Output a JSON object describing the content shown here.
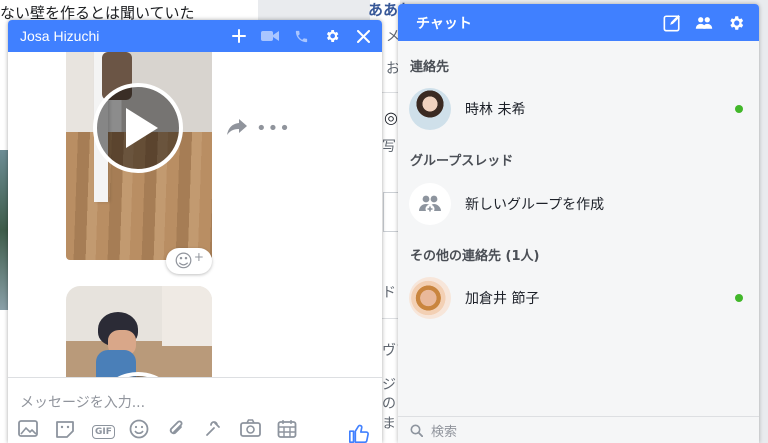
{
  "background": {
    "left_post_text": "ない壁を作るとは聞いていた",
    "mid_post_title": "ああお",
    "fragments": [
      "メ",
      "お",
      "写",
      "ドし",
      "ヴア",
      "ジ",
      "の",
      "ま"
    ]
  },
  "chat_window": {
    "contact_name": "Josa Hizuchi",
    "header_icons": [
      "plus-icon",
      "video-call-icon",
      "phone-icon",
      "gear-icon",
      "close-icon"
    ],
    "message_placeholder": "メッセージを入力...",
    "toolbar_icons": [
      "photo-icon",
      "sticker-icon",
      "gif-icon",
      "emoji-icon",
      "attach-icon",
      "game-icon",
      "camera-icon",
      "calendar-icon",
      "like-icon"
    ],
    "gif_label": "GIF",
    "reaction_plus": "+"
  },
  "sidebar": {
    "title": "チャット",
    "header_icons": [
      "compose-icon",
      "new-group-icon",
      "gear-icon"
    ],
    "sections": {
      "contacts": "連絡先",
      "group_threads": "グループスレッド",
      "other_contacts": "その他の連絡先 (1人)"
    },
    "contacts": [
      {
        "name": "時林 未希",
        "online": true
      },
      {
        "name": "新しいグループを作成",
        "online": false
      },
      {
        "name": "加倉井 節子",
        "online": true
      }
    ],
    "search_placeholder": "検索"
  },
  "colors": {
    "accent": "#4080ff",
    "online": "#42b72a",
    "like": "#4080ff"
  }
}
